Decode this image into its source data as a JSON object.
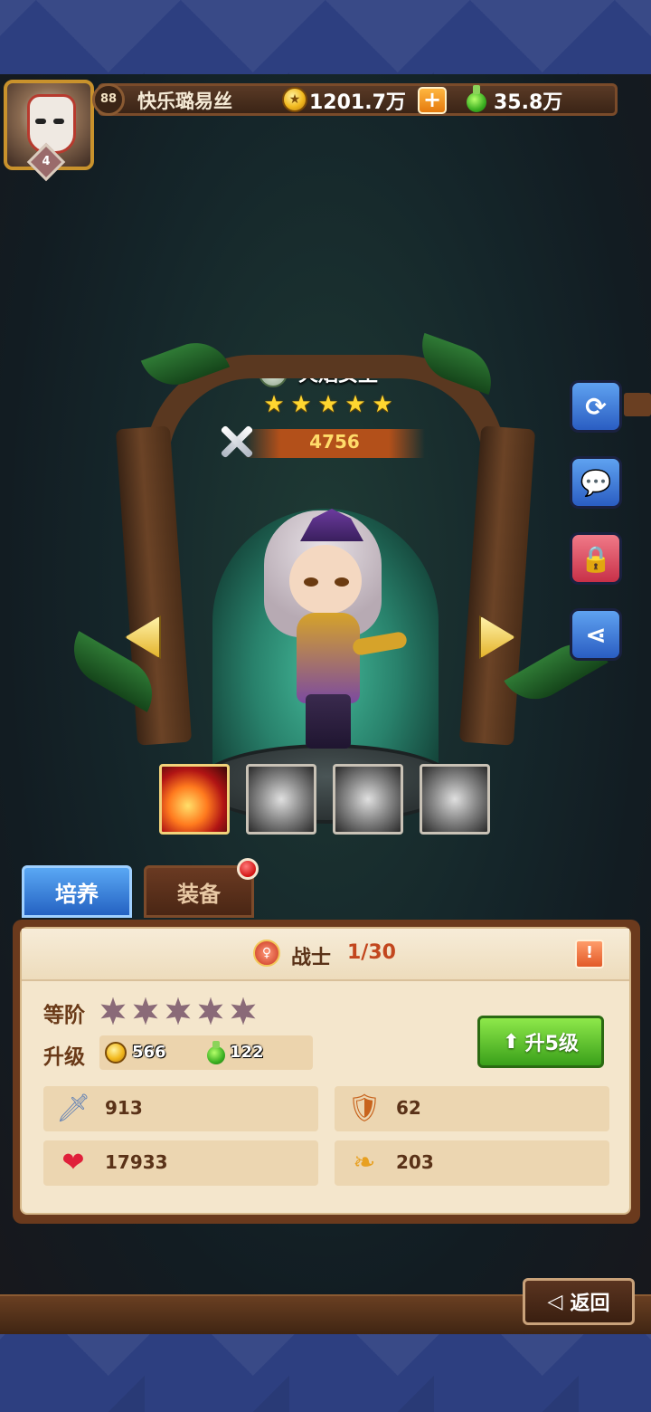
{
  "player": {
    "level": "88",
    "name": "快乐璐易丝",
    "avatar_rank": "4",
    "gold": "1201.7万",
    "plus": "+",
    "potion": "35.8万"
  },
  "hero": {
    "name": "火焰女王",
    "star_count": 5,
    "star_glyph": "★",
    "power": "4756",
    "element_icon": "leaf-icon"
  },
  "side_buttons": [
    "refresh-icon",
    "chat-icon",
    "lock-icon",
    "share-icon"
  ],
  "skills": [
    {
      "name": "fireball-skill",
      "active": true
    },
    {
      "name": "beast-skill",
      "active": false
    },
    {
      "name": "light-skill",
      "active": false
    },
    {
      "name": "smoke-skill",
      "active": false
    }
  ],
  "tabs": {
    "train": "培养",
    "equip": "装备"
  },
  "panel": {
    "class_name": "战士",
    "class_progress": "1/30",
    "info": "!",
    "rank_label": "等阶",
    "rank_stars": 5,
    "upgrade_label": "升级",
    "cost_gold": "566",
    "cost_potion": "122",
    "upgrade_button": "升5级",
    "upgrade_arrow": "⬆",
    "stats": {
      "attack": "913",
      "defense": "62",
      "hp": "17933",
      "speed": "203"
    }
  },
  "back": {
    "label": "返回",
    "arrow": "◁"
  },
  "colors": {
    "panel_bg": "#f4e6cc",
    "tab_active": "#2462c2",
    "upgrade_green": "#3aa01a",
    "power_orange": "#b3501a"
  }
}
